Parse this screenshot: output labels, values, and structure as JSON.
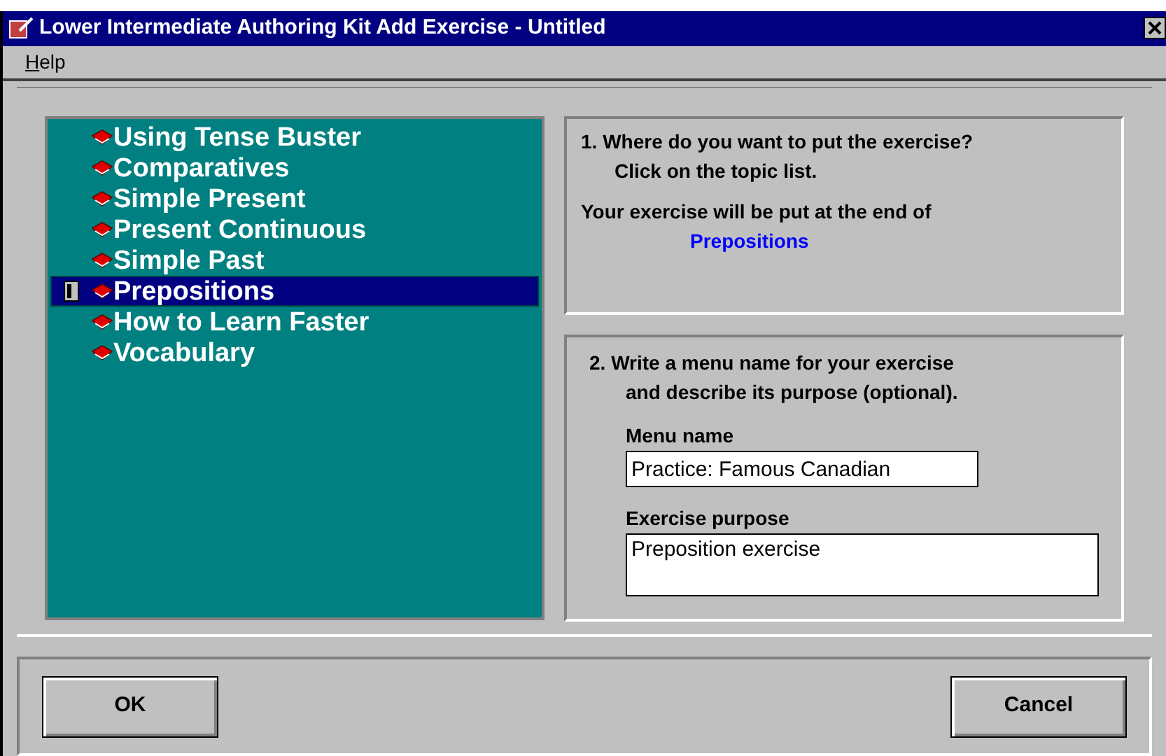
{
  "window": {
    "title": "Lower Intermediate Authoring Kit Add Exercise - Untitled"
  },
  "menu": [
    {
      "label": "Help",
      "access_key_underlined": true
    }
  ],
  "topics": [
    {
      "label": "Using Tense Buster",
      "selected": false
    },
    {
      "label": "Comparatives",
      "selected": false
    },
    {
      "label": "Simple Present",
      "selected": false
    },
    {
      "label": "Present Continuous",
      "selected": false
    },
    {
      "label": "Simple Past",
      "selected": false
    },
    {
      "label": "Prepositions",
      "selected": true
    },
    {
      "label": "How to Learn Faster",
      "selected": false
    },
    {
      "label": "Vocabulary",
      "selected": false
    }
  ],
  "step1": {
    "question": "1. Where do you want to put the exercise?",
    "hint": "Click on the topic list.",
    "destination_label": "Your exercise will be put at the end of",
    "destination": "Prepositions"
  },
  "step2": {
    "instruction_1": "2. Write a menu name for your exercise",
    "instruction_2": "and describe its purpose (optional).",
    "menu_name_label": "Menu name",
    "menu_name": "Practice: Famous Canadian",
    "purpose_label": "Exercise purpose",
    "purpose": "Preposition exercise"
  },
  "buttons": [
    {
      "label": "OK"
    },
    {
      "label": "Cancel"
    }
  ]
}
